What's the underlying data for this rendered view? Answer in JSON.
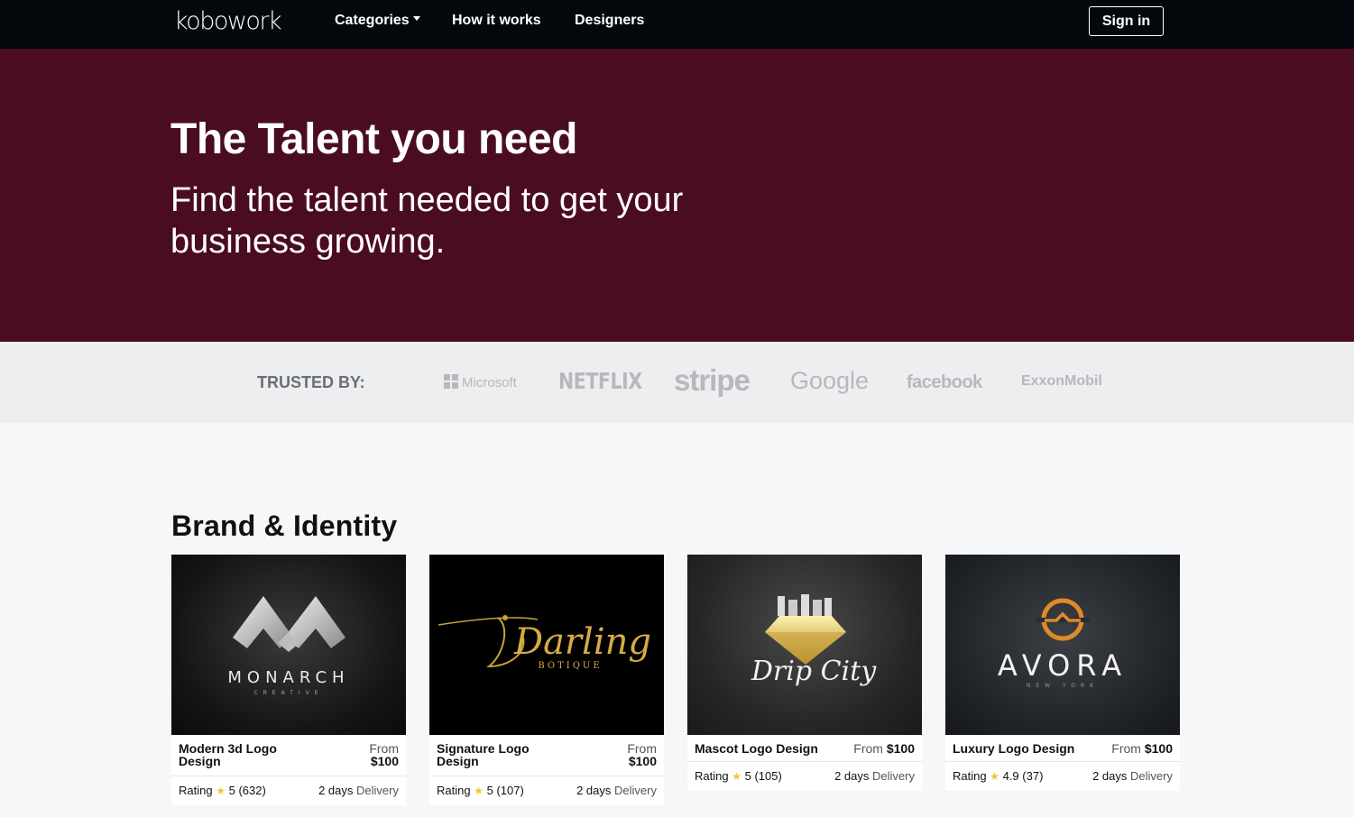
{
  "nav": {
    "logo": "kobowork",
    "categories": "Categories",
    "how_it_works": "How it works",
    "designers": "Designers",
    "sign_in": "Sign in"
  },
  "hero": {
    "title": "The Talent you need",
    "subtitle": "Find the talent needed to get your business growing."
  },
  "trusted": {
    "label": "TRUSTED BY:",
    "brands": [
      "Microsoft",
      "NETFLIX",
      "stripe",
      "Google",
      "facebook",
      "ExxonMobil"
    ]
  },
  "section": {
    "title": "Brand & Identity",
    "cards": [
      {
        "title": "Modern 3d Logo Design",
        "from": "From",
        "price": "$100",
        "rating_label": "Rating",
        "rating": "5",
        "reviews": "(632)",
        "days": "2 days",
        "delivery": "Delivery",
        "image_text": "MONARCH",
        "image_sub": "CREATIVE"
      },
      {
        "title": "Signature Logo Design",
        "from": "From",
        "price": "$100",
        "rating_label": "Rating",
        "rating": "5",
        "reviews": "(107)",
        "days": "2 days",
        "delivery": "Delivery",
        "image_text": "Darling",
        "image_sub": "BOTIQUE"
      },
      {
        "title": "Mascot Logo Design",
        "from": "From",
        "price": "$100",
        "rating_label": "Rating",
        "rating": "5",
        "reviews": "(105)",
        "days": "2 days",
        "delivery": "Delivery",
        "image_text": "Drip City",
        "image_sub": ""
      },
      {
        "title": "Luxury Logo Design",
        "from": "From",
        "price": "$100",
        "rating_label": "Rating",
        "rating": "4.9",
        "reviews": "(37)",
        "days": "2 days",
        "delivery": "Delivery",
        "image_text": "AVORA",
        "image_sub": "NEW YORK"
      }
    ]
  },
  "colors": {
    "nav_bg": "#04080d",
    "hero_bg": "#4a0d1f",
    "star": "#f4c430"
  }
}
